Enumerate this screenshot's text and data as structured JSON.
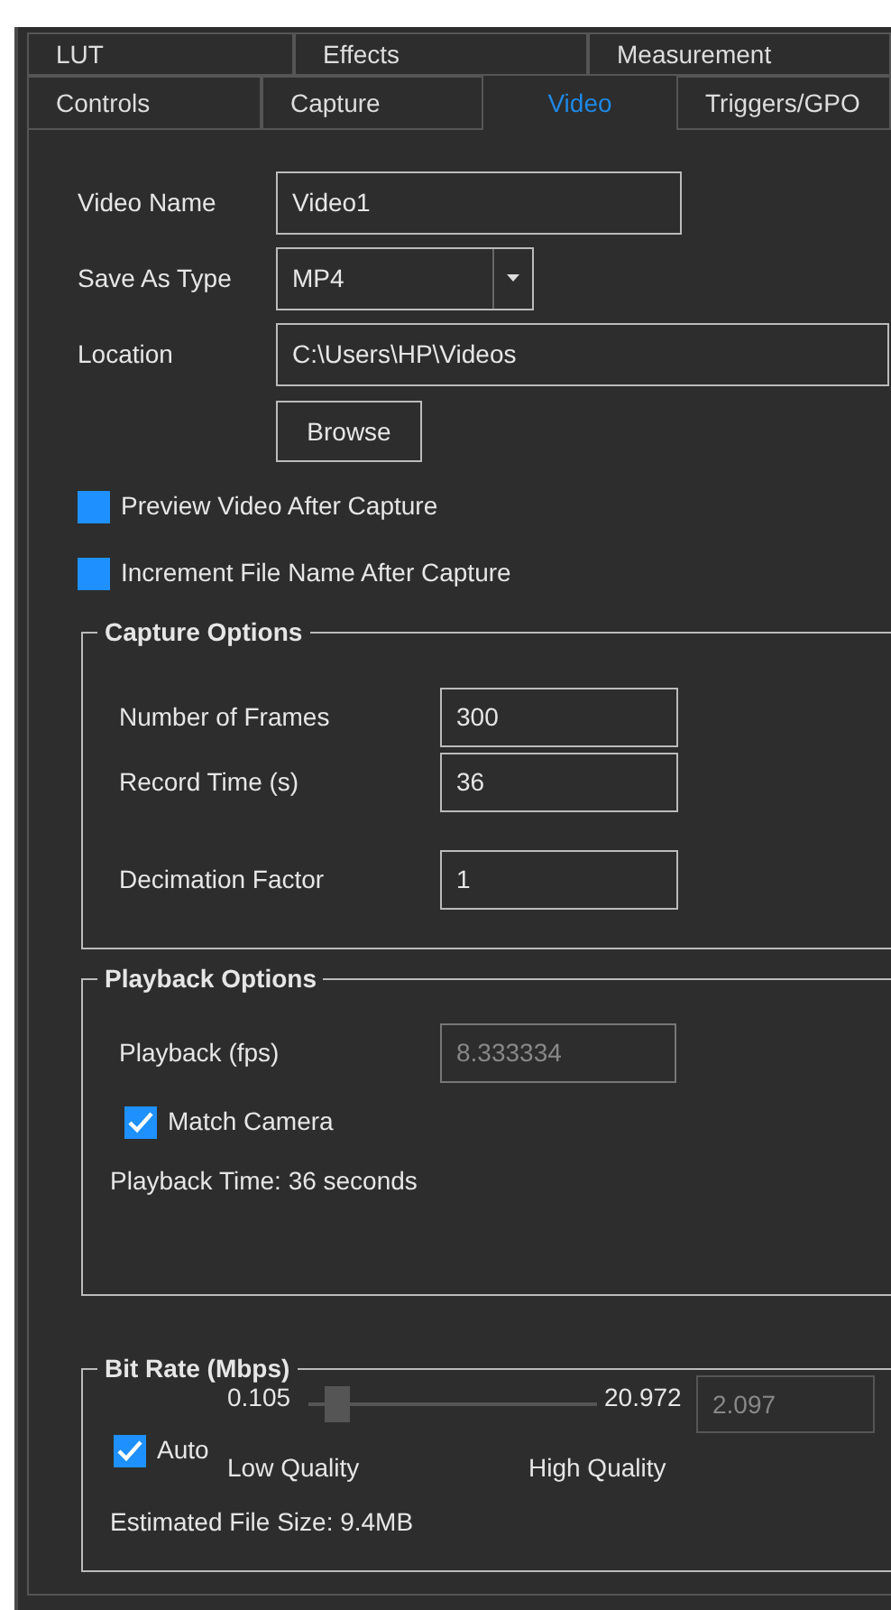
{
  "tabs_row_1": [
    {
      "label": "LUT",
      "selected": false
    },
    {
      "label": "Effects",
      "selected": false
    },
    {
      "label": "Measurement",
      "selected": false
    }
  ],
  "tabs_row_2": [
    {
      "label": "Controls",
      "selected": false
    },
    {
      "label": "Capture",
      "selected": false
    },
    {
      "label": "Video",
      "selected": true
    },
    {
      "label": "Triggers/GPO",
      "selected": false
    }
  ],
  "video_name": {
    "label": "Video Name",
    "value": "Video1"
  },
  "save_as_type": {
    "label": "Save As Type",
    "value": "MP4"
  },
  "location": {
    "label": "Location",
    "value": "C:\\Users\\HP\\Videos"
  },
  "browse_button": "Browse",
  "options": [
    {
      "label": "Preview Video After Capture",
      "checked": false
    },
    {
      "label": "Increment File Name After Capture",
      "checked": false
    }
  ],
  "capture_options": {
    "title": "Capture Options",
    "fields": [
      {
        "label": "Number of Frames",
        "value": "300"
      },
      {
        "label": "Record Time (s)",
        "value": "36"
      },
      {
        "label": "Decimation Factor",
        "value": "1"
      }
    ]
  },
  "playback_options": {
    "title": "Playback Options",
    "fps_label": "Playback (fps)",
    "fps_value": "8.333334",
    "fps_disabled": true,
    "match_camera": {
      "label": "Match Camera",
      "checked": true
    },
    "playback_time": "Playback Time: 36 seconds"
  },
  "bit_rate": {
    "title": "Bit Rate (Mbps)",
    "auto": {
      "label": "Auto",
      "checked": true
    },
    "min": "0.105",
    "max": "20.972",
    "level": 0.1,
    "value": "2.097",
    "value_disabled": true,
    "low_label": "Low Quality",
    "high_label": "High Quality",
    "estimated_size": "Estimated File Size: 9.4MB"
  }
}
